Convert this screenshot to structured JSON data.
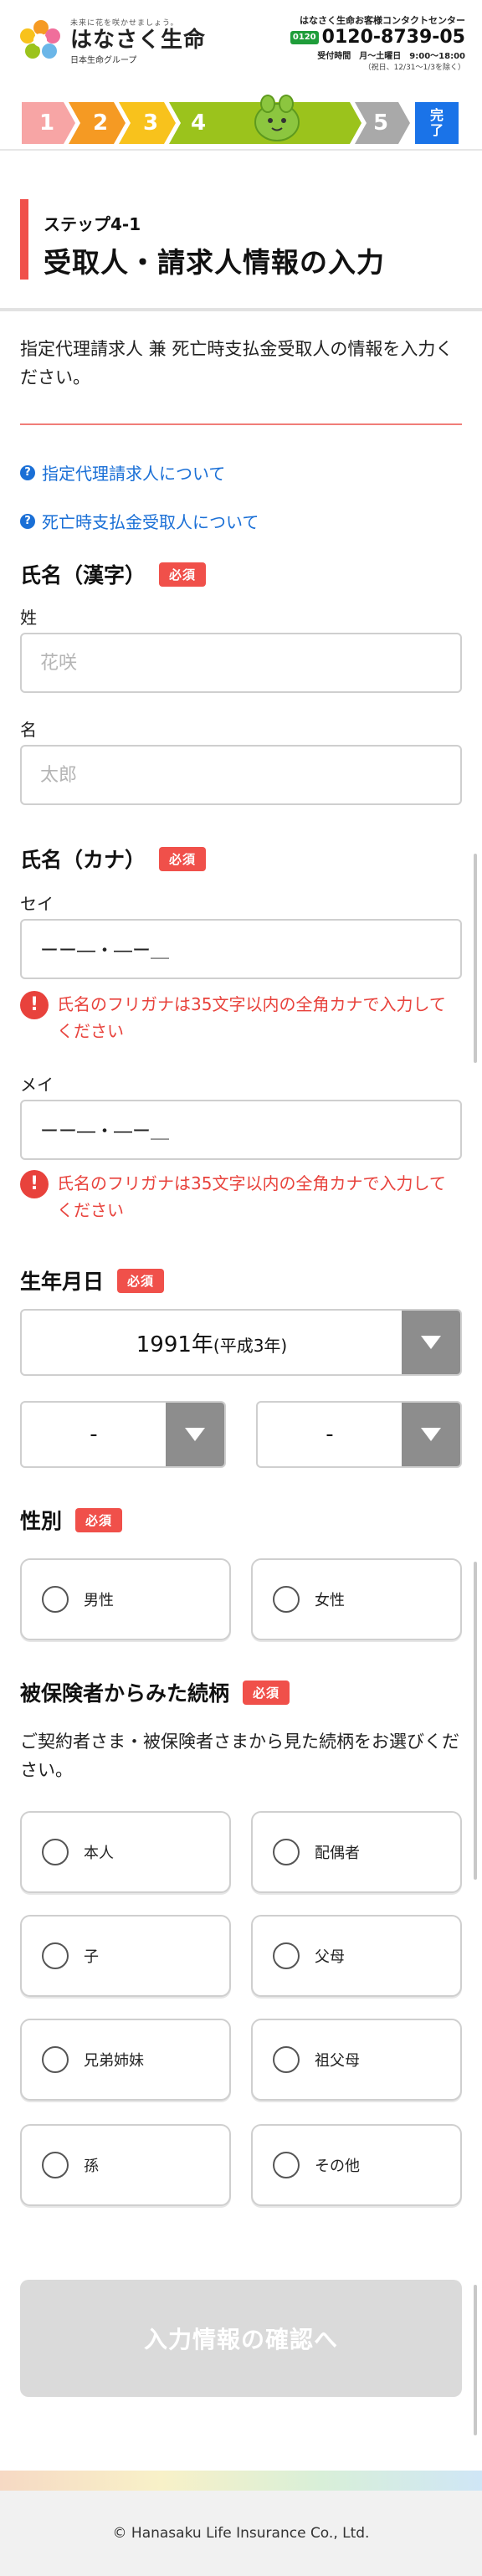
{
  "header": {
    "tagline": "未来に花を咲かせましょう。",
    "company": "はなさく生命",
    "group": "日本生命グループ",
    "contact_title": "はなさく生命お客様コンタクトセンター",
    "free_badge": "0120",
    "tel": "0120-8739-05",
    "hours": "受付時間　月〜土曜日　9:00〜18:00",
    "holidays": "（祝日、12/31〜1/3を除く）"
  },
  "steps": [
    "1",
    "2",
    "3",
    "4",
    "5",
    "完了"
  ],
  "page": {
    "step_label": "ステップ4-1",
    "title": "受取人・請求人情報の入力",
    "intro": "指定代理請求人 兼 死亡時支払金受取人の情報を入力ください。"
  },
  "links": {
    "agent": "指定代理請求人について",
    "beneficiary": "死亡時支払金受取人について",
    "icon": "?"
  },
  "required_label": "必須",
  "name_kanji": {
    "label": "氏名（漢字）",
    "last_label": "姓",
    "last_placeholder": "花咲",
    "first_label": "名",
    "first_placeholder": "太郎"
  },
  "name_kana": {
    "label": "氏名（カナ）",
    "last_label": "セイ",
    "last_value": "ーー―・―ー＿",
    "first_label": "メイ",
    "first_value": "ーー―・―ー＿",
    "error": "氏名のフリガナは35文字以内の全角カナで入力してください",
    "error_icon": "!"
  },
  "birth": {
    "label": "生年月日",
    "year": "1991年",
    "era": "(平成3年)",
    "month": "-",
    "day": "-"
  },
  "gender": {
    "label": "性別",
    "options": [
      "男性",
      "女性"
    ]
  },
  "relation": {
    "label": "被保険者からみた続柄",
    "description": "ご契約者さま・被保険者さまから見た続柄をお選びください。",
    "options": [
      "本人",
      "配偶者",
      "子",
      "父母",
      "兄弟姉妹",
      "祖父母",
      "孫",
      "その他"
    ]
  },
  "submit_label": "入力情報の確認へ",
  "footer": "© Hanasaku Life Insurance Co., Ltd.",
  "colors": {
    "accent": "#f0504a",
    "link": "#1a6fd6",
    "step1": "#f7a5a5",
    "step2": "#f59a23",
    "step3": "#f8c21c",
    "step4": "#9bc31c",
    "step5": "#a9a9a9",
    "done": "#1a73e8"
  }
}
